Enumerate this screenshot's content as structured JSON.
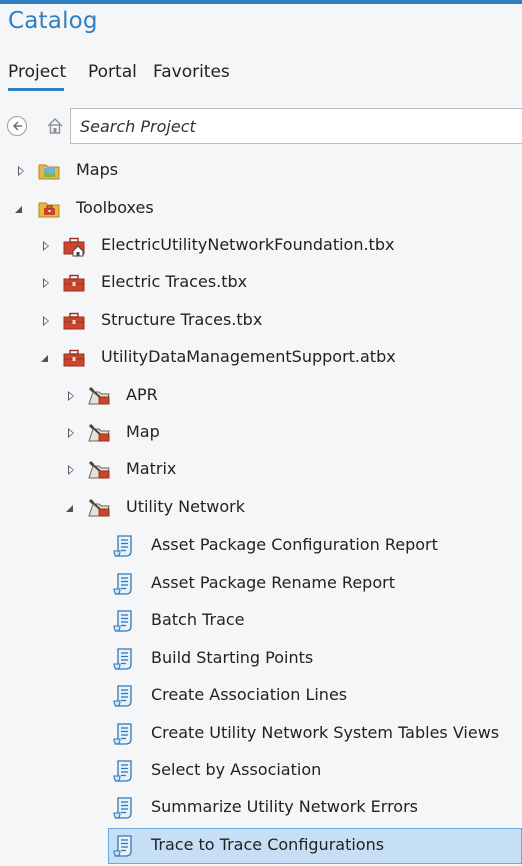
{
  "panel": {
    "title": "Catalog"
  },
  "tabs": [
    {
      "label": "Project",
      "active": true
    },
    {
      "label": "Portal",
      "active": false
    },
    {
      "label": "Favorites",
      "active": false
    }
  ],
  "search": {
    "placeholder": "Search Project",
    "value": ""
  },
  "tree": [
    {
      "label": "Maps",
      "icon": "maps-folder-icon",
      "state": "collapsed"
    },
    {
      "label": "Toolboxes",
      "icon": "toolboxes-folder-icon",
      "state": "expanded"
    },
    {
      "label": "ElectricUtilityNetworkFoundation.tbx",
      "icon": "toolbox-home-icon",
      "state": "collapsed"
    },
    {
      "label": "Electric Traces.tbx",
      "icon": "toolbox-icon",
      "state": "collapsed"
    },
    {
      "label": "Structure Traces.tbx",
      "icon": "toolbox-icon",
      "state": "collapsed"
    },
    {
      "label": "UtilityDataManagementSupport.atbx",
      "icon": "toolbox-icon",
      "state": "expanded"
    },
    {
      "label": "APR",
      "icon": "toolset-icon",
      "state": "collapsed"
    },
    {
      "label": "Map",
      "icon": "toolset-icon",
      "state": "collapsed"
    },
    {
      "label": "Matrix",
      "icon": "toolset-icon",
      "state": "collapsed"
    },
    {
      "label": "Utility Network",
      "icon": "toolset-icon",
      "state": "expanded"
    },
    {
      "label": "Asset Package Configuration Report",
      "icon": "script-tool-icon",
      "state": "leaf"
    },
    {
      "label": "Asset Package Rename Report",
      "icon": "script-tool-icon",
      "state": "leaf"
    },
    {
      "label": "Batch Trace",
      "icon": "script-tool-icon",
      "state": "leaf"
    },
    {
      "label": "Build Starting Points",
      "icon": "script-tool-icon",
      "state": "leaf"
    },
    {
      "label": "Create Association Lines",
      "icon": "script-tool-icon",
      "state": "leaf"
    },
    {
      "label": "Create Utility Network System Tables Views",
      "icon": "script-tool-icon",
      "state": "leaf"
    },
    {
      "label": "Select by Association",
      "icon": "script-tool-icon",
      "state": "leaf"
    },
    {
      "label": "Summarize Utility Network Errors",
      "icon": "script-tool-icon",
      "state": "leaf"
    },
    {
      "label": "Trace to Trace Configurations",
      "icon": "script-tool-icon",
      "state": "leaf",
      "selected": true
    }
  ],
  "colors": {
    "accent": "#2f7fc1",
    "selection": "#c7dff4",
    "selection_border": "#6fa9dc",
    "toolbox_red": "#c9452e",
    "folder_yellow": "#e8b93c"
  }
}
